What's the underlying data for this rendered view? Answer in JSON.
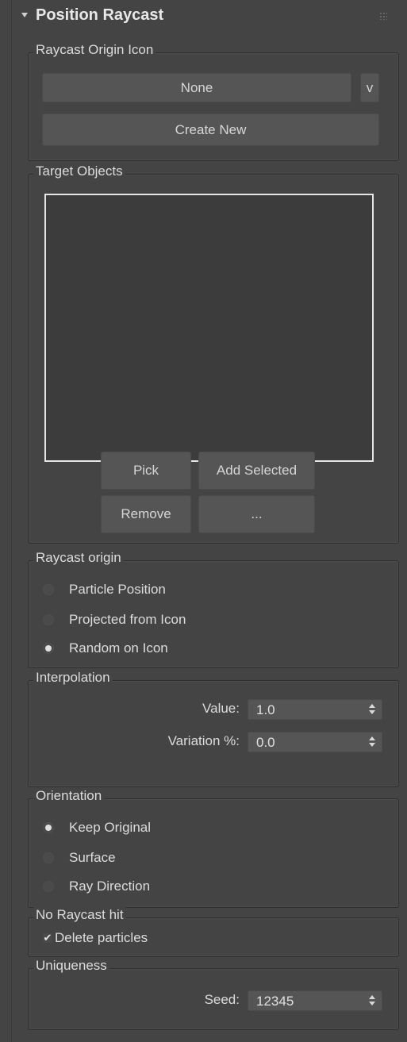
{
  "header": {
    "title": "Position Raycast"
  },
  "origin_icon_group": {
    "legend": "Raycast Origin Icon",
    "selected": "None",
    "dropdown_label": "v",
    "create_label": "Create New"
  },
  "targets_group": {
    "legend": "Target Objects",
    "pick_label": "Pick",
    "add_selected_label": "Add Selected",
    "remove_label": "Remove",
    "more_label": "..."
  },
  "raycast_origin": {
    "legend": "Raycast origin",
    "options": [
      "Particle Position",
      "Projected from Icon",
      "Random on Icon"
    ],
    "selected_index": 2
  },
  "interpolation": {
    "legend": "Interpolation",
    "value_label": "Value:",
    "value": "1.0",
    "variation_label": "Variation %:",
    "variation": "0.0"
  },
  "orientation": {
    "legend": "Orientation",
    "options": [
      "Keep Original",
      "Surface",
      "Ray Direction"
    ],
    "selected_index": 0
  },
  "no_hit": {
    "legend": "No Raycast hit",
    "checkbox_label": "Delete particles",
    "checked": true
  },
  "uniqueness": {
    "legend": "Uniqueness",
    "seed_label": "Seed:",
    "seed": "12345"
  }
}
